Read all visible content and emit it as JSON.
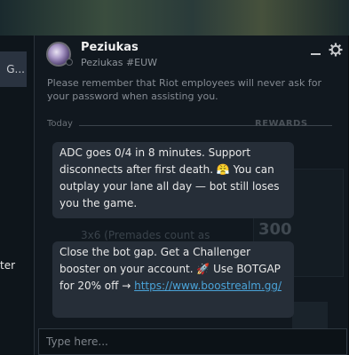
{
  "background": {
    "left_tab_label": "G...",
    "left_text": "ter",
    "ghost_number": "300",
    "ghost_text": "3x6 (Premades count as",
    "rewards_label": "REWARDS"
  },
  "chat": {
    "name": "Peziukas",
    "tag": "Peziukas #EUW",
    "notice": "Please remember that Riot employees will never ask for your password when assisting you.",
    "day_label": "Today",
    "messages": [
      {
        "text": "ADC goes 0/4 in 8 minutes. Support disconnects after first death. 😤 You can outplay your lane all day — bot still loses you the game."
      },
      {
        "text_before_link": "Close the bot gap. Get a Challenger booster on your account. 🚀 Use BOTGAP for 20% off →",
        "link": "https://www.boostrealm.gg/"
      }
    ],
    "input_placeholder": "Type here..."
  },
  "icons": {
    "minimize": "minimize-icon",
    "settings": "gear-icon"
  }
}
